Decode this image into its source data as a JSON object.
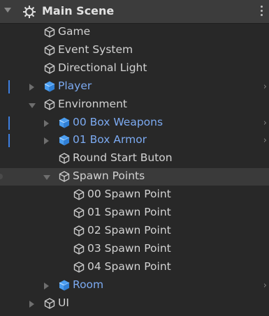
{
  "header": {
    "title": "Main Scene",
    "scene_icon": "unity-scene-icon",
    "menu_icon": "kebab-menu-icon"
  },
  "items": [
    {
      "label": "Game",
      "depth": 0,
      "icon": "gameobject-icon",
      "prefab": false,
      "arrow": "none",
      "chevron": false
    },
    {
      "label": "Event System",
      "depth": 0,
      "icon": "gameobject-icon",
      "prefab": false,
      "arrow": "none",
      "chevron": false
    },
    {
      "label": "Directional Light",
      "depth": 0,
      "icon": "gameobject-icon",
      "prefab": false,
      "arrow": "none",
      "chevron": false
    },
    {
      "label": "Player",
      "depth": 0,
      "icon": "prefab-icon",
      "prefab": true,
      "arrow": "collapsed",
      "chevron": true
    },
    {
      "label": "Environment",
      "depth": 0,
      "icon": "gameobject-icon",
      "prefab": false,
      "arrow": "expanded",
      "chevron": false
    },
    {
      "label": "00 Box Weapons",
      "depth": 1,
      "icon": "prefab-icon",
      "prefab": true,
      "arrow": "collapsed",
      "chevron": true
    },
    {
      "label": "01 Box Armor",
      "depth": 1,
      "icon": "prefab-icon",
      "prefab": true,
      "arrow": "collapsed",
      "chevron": true
    },
    {
      "label": "Round Start Buton",
      "depth": 1,
      "icon": "gameobject-icon",
      "prefab": false,
      "arrow": "none",
      "chevron": false
    },
    {
      "label": "Spawn Points",
      "depth": 1,
      "icon": "gameobject-icon",
      "prefab": false,
      "arrow": "expanded",
      "chevron": false,
      "selected": true
    },
    {
      "label": "00 Spawn Point",
      "depth": 2,
      "icon": "gameobject-icon",
      "prefab": false,
      "arrow": "none",
      "chevron": false
    },
    {
      "label": "01 Spawn Point",
      "depth": 2,
      "icon": "gameobject-icon",
      "prefab": false,
      "arrow": "none",
      "chevron": false
    },
    {
      "label": "02 Spawn Point",
      "depth": 2,
      "icon": "gameobject-icon",
      "prefab": false,
      "arrow": "none",
      "chevron": false
    },
    {
      "label": "03 Spawn Point",
      "depth": 2,
      "icon": "gameobject-icon",
      "prefab": false,
      "arrow": "none",
      "chevron": false
    },
    {
      "label": "04 Spawn Point",
      "depth": 2,
      "icon": "gameobject-icon",
      "prefab": false,
      "arrow": "none",
      "chevron": false
    },
    {
      "label": "Room",
      "depth": 1,
      "icon": "prefab-icon",
      "prefab": true,
      "arrow": "collapsed",
      "chevron": true
    },
    {
      "label": "UI",
      "depth": 0,
      "icon": "gameobject-icon",
      "prefab": false,
      "arrow": "collapsed",
      "chevron": false
    }
  ],
  "colors": {
    "background": "#282828",
    "header": "#3c3c3c",
    "prefab_text": "#7caaf1",
    "prefab_icon": "#4a9df0",
    "prefab_bar": "#3d7fe0"
  }
}
